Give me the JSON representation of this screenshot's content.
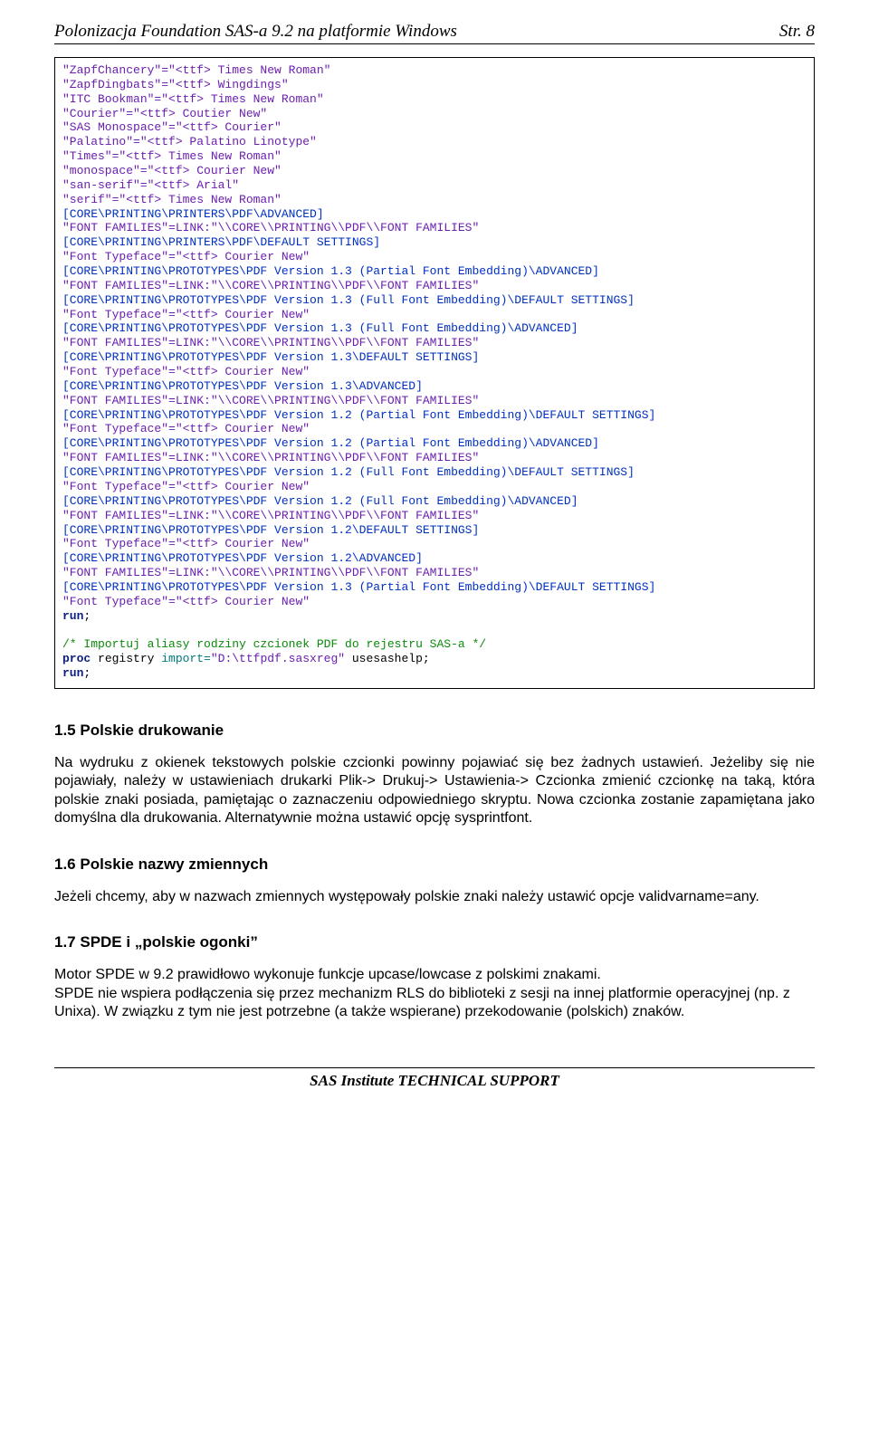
{
  "header": {
    "title": "Polonizacja Foundation SAS-a 9.2 na platformie Windows",
    "page": "Str. 8"
  },
  "code": {
    "lines": [
      {
        "t": "\"ZapfChancery\"=\"<ttf> Times New Roman\"",
        "c": "purple"
      },
      {
        "t": "\"ZapfDingbats\"=\"<ttf> Wingdings\"",
        "c": "purple"
      },
      {
        "t": "\"ITC Bookman\"=\"<ttf> Times New Roman\"",
        "c": "purple"
      },
      {
        "t": "\"Courier\"=\"<ttf> Coutier New\"",
        "c": "purple"
      },
      {
        "t": "\"SAS Monospace\"=\"<ttf> Courier\"",
        "c": "purple"
      },
      {
        "t": "\"Palatino\"=\"<ttf> Palatino Linotype\"",
        "c": "purple"
      },
      {
        "t": "\"Times\"=\"<ttf> Times New Roman\"",
        "c": "purple"
      },
      {
        "t": "\"monospace\"=\"<ttf> Courier New\"",
        "c": "purple"
      },
      {
        "t": "\"san-serif\"=\"<ttf> Arial\"",
        "c": "purple"
      },
      {
        "t": "\"serif\"=\"<ttf> Times New Roman\"",
        "c": "purple"
      },
      {
        "t": "[CORE\\PRINTING\\PRINTERS\\PDF\\ADVANCED]",
        "c": "blue"
      },
      {
        "t": "\"FONT FAMILIES\"=LINK:\"\\\\CORE\\\\PRINTING\\\\PDF\\\\FONT FAMILIES\"",
        "c": "purple"
      },
      {
        "t": "[CORE\\PRINTING\\PRINTERS\\PDF\\DEFAULT SETTINGS]",
        "c": "blue"
      },
      {
        "t": "\"Font Typeface\"=\"<ttf> Courier New\"",
        "c": "purple"
      },
      {
        "t": "[CORE\\PRINTING\\PROTOTYPES\\PDF Version 1.3 (Partial Font Embedding)\\ADVANCED]",
        "c": "blue"
      },
      {
        "t": "\"FONT FAMILIES\"=LINK:\"\\\\CORE\\\\PRINTING\\\\PDF\\\\FONT FAMILIES\"",
        "c": "purple"
      },
      {
        "t": "[CORE\\PRINTING\\PROTOTYPES\\PDF Version 1.3 (Full Font Embedding)\\DEFAULT SETTINGS]",
        "c": "blue"
      },
      {
        "t": "\"Font Typeface\"=\"<ttf> Courier New\"",
        "c": "purple"
      },
      {
        "t": "[CORE\\PRINTING\\PROTOTYPES\\PDF Version 1.3 (Full Font Embedding)\\ADVANCED]",
        "c": "blue"
      },
      {
        "t": "\"FONT FAMILIES\"=LINK:\"\\\\CORE\\\\PRINTING\\\\PDF\\\\FONT FAMILIES\"",
        "c": "purple"
      },
      {
        "t": "[CORE\\PRINTING\\PROTOTYPES\\PDF Version 1.3\\DEFAULT SETTINGS]",
        "c": "blue"
      },
      {
        "t": "\"Font Typeface\"=\"<ttf> Courier New\"",
        "c": "purple"
      },
      {
        "t": "[CORE\\PRINTING\\PROTOTYPES\\PDF Version 1.3\\ADVANCED]",
        "c": "blue"
      },
      {
        "t": "\"FONT FAMILIES\"=LINK:\"\\\\CORE\\\\PRINTING\\\\PDF\\\\FONT FAMILIES\"",
        "c": "purple"
      },
      {
        "t": "[CORE\\PRINTING\\PROTOTYPES\\PDF Version 1.2 (Partial Font Embedding)\\DEFAULT SETTINGS]",
        "c": "blue"
      },
      {
        "t": "\"Font Typeface\"=\"<ttf> Courier New\"",
        "c": "purple"
      },
      {
        "t": "[CORE\\PRINTING\\PROTOTYPES\\PDF Version 1.2 (Partial Font Embedding)\\ADVANCED]",
        "c": "blue"
      },
      {
        "t": "\"FONT FAMILIES\"=LINK:\"\\\\CORE\\\\PRINTING\\\\PDF\\\\FONT FAMILIES\"",
        "c": "purple"
      },
      {
        "t": "[CORE\\PRINTING\\PROTOTYPES\\PDF Version 1.2 (Full Font Embedding)\\DEFAULT SETTINGS]",
        "c": "blue"
      },
      {
        "t": "\"Font Typeface\"=\"<ttf> Courier New\"",
        "c": "purple"
      },
      {
        "t": "[CORE\\PRINTING\\PROTOTYPES\\PDF Version 1.2 (Full Font Embedding)\\ADVANCED]",
        "c": "blue"
      },
      {
        "t": "\"FONT FAMILIES\"=LINK:\"\\\\CORE\\\\PRINTING\\\\PDF\\\\FONT FAMILIES\"",
        "c": "purple"
      },
      {
        "t": "[CORE\\PRINTING\\PROTOTYPES\\PDF Version 1.2\\DEFAULT SETTINGS]",
        "c": "blue"
      },
      {
        "t": "\"Font Typeface\"=\"<ttf> Courier New\"",
        "c": "purple"
      },
      {
        "t": "[CORE\\PRINTING\\PROTOTYPES\\PDF Version 1.2\\ADVANCED]",
        "c": "blue"
      },
      {
        "t": "\"FONT FAMILIES\"=LINK:\"\\\\CORE\\\\PRINTING\\\\PDF\\\\FONT FAMILIES\"",
        "c": "purple"
      },
      {
        "t": "[CORE\\PRINTING\\PROTOTYPES\\PDF Version 1.3 (Partial Font Embedding)\\DEFAULT SETTINGS]",
        "c": "blue"
      },
      {
        "t": "\"Font Typeface\"=\"<ttf> Courier New\"",
        "c": "purple"
      }
    ],
    "run1": "run",
    "semi1": ";",
    "blank": "",
    "comment": "/* Importuj aliasy rodziny czcionek PDF do rejestru SAS-a */",
    "proc_parts": {
      "proc": "proc",
      "registry": " registry ",
      "import_eq": "import=",
      "path": "\"D:\\ttfpdf.sasxreg\"",
      "usesashelp": " usesashelp;"
    },
    "run2": "run",
    "semi2": ";"
  },
  "sec15": {
    "title": "1.5 Polskie drukowanie",
    "p1": "Na wydruku z okienek tekstowych polskie czcionki powinny pojawiać się bez żadnych ustawień. Jeżeliby się nie pojawiały, należy w ustawieniach drukarki Plik-> Drukuj-> Ustawienia-> Czcionka zmienić czcionkę na taką, która polskie znaki posiada, pamiętając o zaznaczeniu odpowiedniego skryptu.  Nowa czcionka zostanie zapamiętana  jako domyślna dla drukowania. Alternatywnie można ustawić opcję sysprintfont."
  },
  "sec16": {
    "title": "1.6 Polskie nazwy zmiennych",
    "p1": "Jeżeli chcemy, aby w nazwach zmiennych  występowały polskie znaki należy ustawić opcje validvarname=any."
  },
  "sec17": {
    "title": "1.7 SPDE i „polskie ogonki”",
    "p1": "Motor SPDE w 9.2 prawidłowo wykonuje funkcje upcase/lowcase z polskimi znakami.\nSPDE nie wspiera podłączenia się przez mechanizm RLS do biblioteki z sesji na innej platformie operacyjnej (np. z Unixa). W związku z tym nie jest potrzebne (a także wspierane) przekodowanie (polskich) znaków."
  },
  "footer": {
    "text": "SAS Institute TECHNICAL SUPPORT"
  }
}
